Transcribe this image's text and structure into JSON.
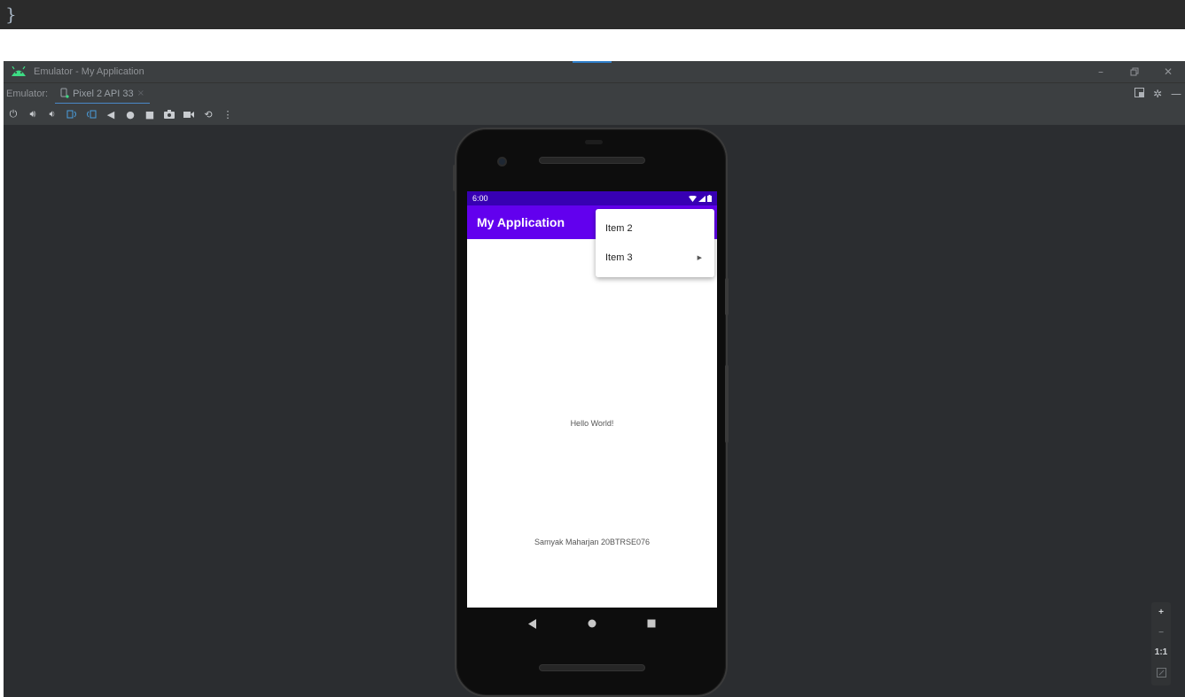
{
  "code_strip": {
    "text": "}"
  },
  "window": {
    "title": "Emulator - My Application",
    "controls": [
      "minimize-icon",
      "restore-icon",
      "close-icon"
    ]
  },
  "tabbar": {
    "prefix": "Emulator:",
    "tab_label": "Pixel 2 API 33",
    "tab_close": "×"
  },
  "toolbar": {
    "buttons": [
      "power-icon",
      "volume-up-icon",
      "volume-down-icon",
      "rotate-left-icon",
      "rotate-right-icon",
      "back-icon",
      "home-icon",
      "overview-icon",
      "screenshot-icon",
      "screenrecord-icon",
      "snapshot-icon",
      "more-icon"
    ]
  },
  "device": {
    "status_time": "6:00",
    "app_title": "My Application",
    "menu_items": [
      {
        "label": "Item 2"
      },
      {
        "label": "Item 3",
        "has_submenu": true
      }
    ],
    "hello_text": "Hello World!",
    "name_text": "Samyak Maharjan 20BTRSE076",
    "colors": {
      "status_bar": "#3700b3",
      "app_bar": "#6200ee"
    }
  },
  "zoom": {
    "plus": "+",
    "minus": "−",
    "one_to_one": "1:1"
  }
}
